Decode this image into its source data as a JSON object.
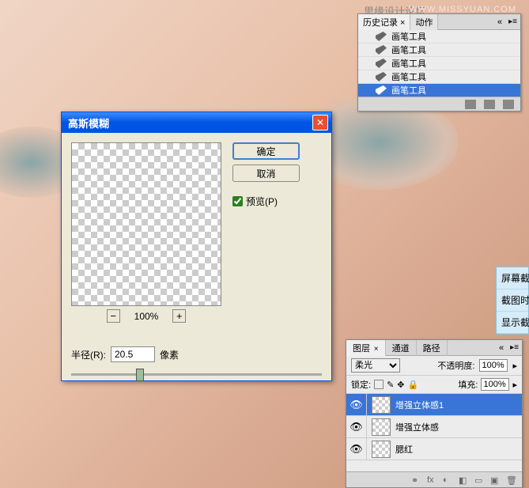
{
  "watermark": "WWW.MISSYUAN.COM",
  "header_text": "思缘设计论坛",
  "history_panel": {
    "tab1": "历史记录 ×",
    "tab2": "动作",
    "items": [
      "画笔工具",
      "画笔工具",
      "画笔工具",
      "画笔工具",
      "画笔工具"
    ]
  },
  "gauss": {
    "title": "高斯模糊",
    "ok": "确定",
    "cancel": "取消",
    "preview_label": "预览(P)",
    "zoom_value": "100%",
    "radius_label": "半径(R):",
    "radius_value": "20.5",
    "radius_unit": "像素"
  },
  "side_menu": {
    "items": [
      "屏幕截",
      "截图时",
      "显示截"
    ]
  },
  "layers": {
    "tab1": "图层",
    "tab2": "通道",
    "tab3": "路径",
    "blend_mode": "柔光",
    "opacity_label": "不透明度:",
    "opacity_value": "100%",
    "lock_label": "锁定:",
    "fill_label": "填充:",
    "fill_value": "100%",
    "items": [
      "增强立体感1",
      "增强立体感",
      "腮红"
    ]
  }
}
